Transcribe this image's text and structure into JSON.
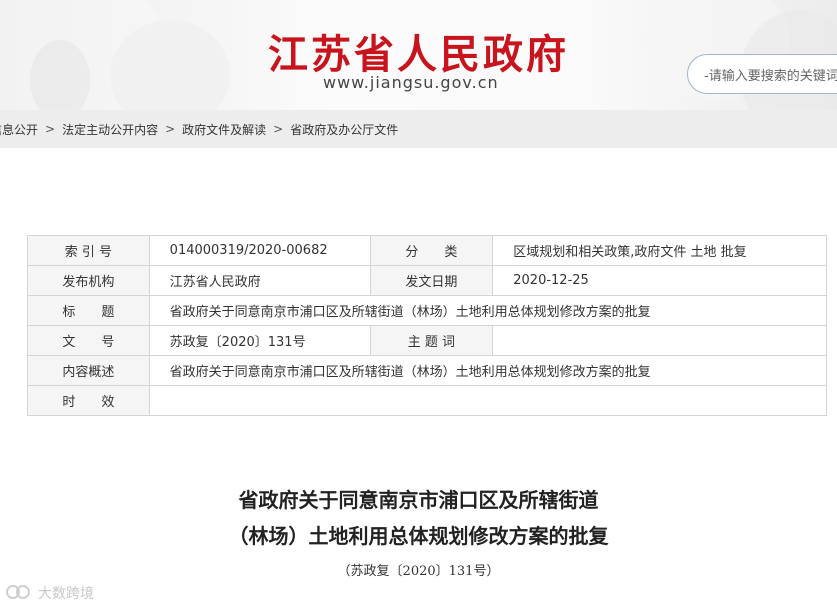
{
  "header": {
    "site_title": "江苏省人民政府",
    "site_url": "www.jiangsu.gov.cn",
    "search_placeholder": "-请输入要搜索的关键词-"
  },
  "breadcrumb": {
    "items": [
      "信息公开",
      "法定主动公开内容",
      "政府文件及解读",
      "省政府及办公厅文件"
    ],
    "separator": ">"
  },
  "info_table": {
    "rows": [
      {
        "label1": "索 引 号",
        "value1": "014000319/2020-00682",
        "label2": "分　　类",
        "value2": "区域规划和相关政策,政府文件 土地 批复"
      },
      {
        "label1": "发布机构",
        "value1": "江苏省人民政府",
        "label2": "发文日期",
        "value2": "2020-12-25"
      },
      {
        "label": "标　　题",
        "value": "省政府关于同意南京市浦口区及所辖街道（林场）土地利用总体规划修改方案的批复"
      },
      {
        "label1": "文　　号",
        "value1": "苏政复〔2020〕131号",
        "label2": "主 题 词",
        "value2": ""
      },
      {
        "label": "内容概述",
        "value": "省政府关于同意南京市浦口区及所辖街道（林场）土地利用总体规划修改方案的批复"
      },
      {
        "label": "时　　效",
        "value": ""
      }
    ]
  },
  "article": {
    "title_line1": "省政府关于同意南京市浦口区及所辖街道",
    "title_line2": "（林场）土地利用总体规划修改方案的批复",
    "doc_number": "（苏政复〔2020〕131号）"
  },
  "watermark": {
    "text": "大数跨境"
  },
  "colors": {
    "brand_red": "#c8141c",
    "breadcrumb_bg": "#ededed",
    "table_border": "#d4d4d4",
    "label_bg": "#f5f5f5"
  }
}
